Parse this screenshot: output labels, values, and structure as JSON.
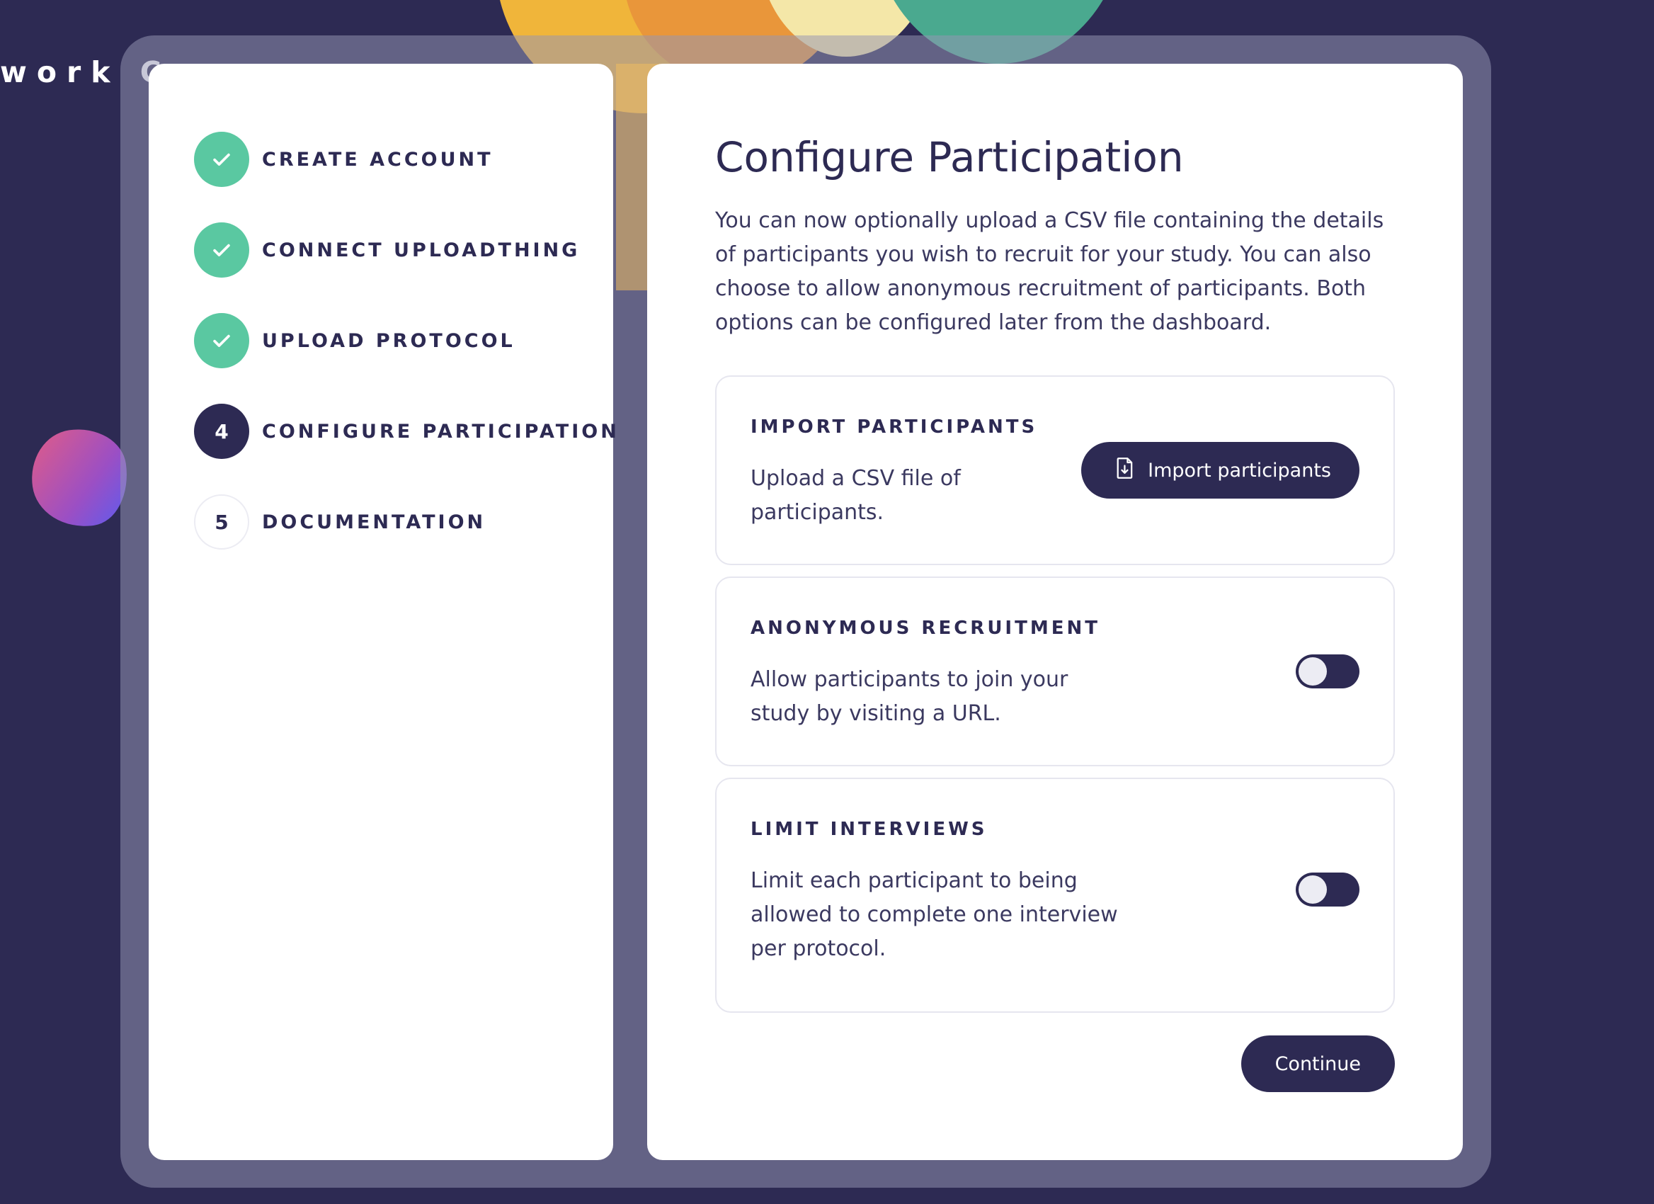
{
  "background": {
    "partial_text": "work C"
  },
  "steps": [
    {
      "label": "CREATE ACCOUNT",
      "status": "complete",
      "icon": "check-icon"
    },
    {
      "label": "CONNECT UPLOADTHING",
      "status": "complete",
      "icon": "check-icon"
    },
    {
      "label": "UPLOAD PROTOCOL",
      "status": "complete",
      "icon": "check-icon"
    },
    {
      "label": "CONFIGURE PARTICIPATION",
      "status": "active",
      "number": "4"
    },
    {
      "label": "DOCUMENTATION",
      "status": "pending",
      "number": "5"
    }
  ],
  "main": {
    "title": "Configure Participation",
    "description": "You can now optionally upload a CSV file containing the details of participants you wish to recruit for your study. You can also choose to allow anonymous recruitment of participants. Both options can be configured later from the dashboard.",
    "import_card": {
      "title": "IMPORT PARTICIPANTS",
      "text": "Upload a CSV file of participants.",
      "button_label": "Import participants",
      "button_icon": "file-import-icon"
    },
    "anonymous_card": {
      "title": "ANONYMOUS RECRUITMENT",
      "text": "Allow participants to join your study by visiting a URL.",
      "toggle_on": false
    },
    "limit_card": {
      "title": "LIMIT INTERVIEWS",
      "text": "Limit each participant to being allowed to complete one interview per protocol.",
      "toggle_on": false
    },
    "continue_label": "Continue"
  },
  "colors": {
    "background": "#2d2a53",
    "primary": "#2d2a53",
    "complete": "#5ac8a1"
  }
}
